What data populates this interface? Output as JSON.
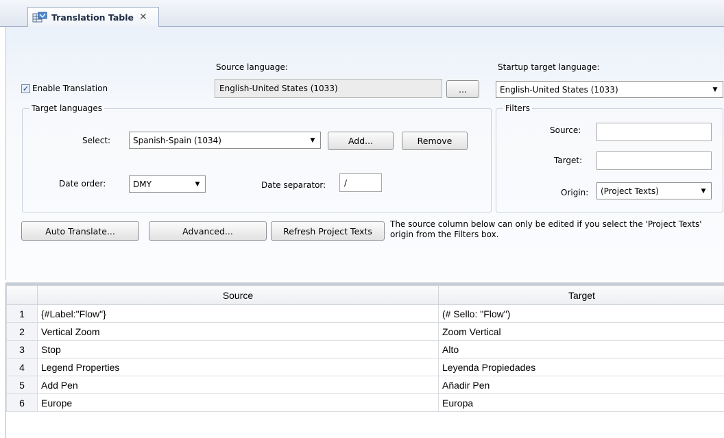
{
  "tab": {
    "title": "Translation Table",
    "close": "✕",
    "icon": "translation-table-icon"
  },
  "top": {
    "enable_translation": {
      "label": "Enable Translation",
      "checked": true
    },
    "source_language": {
      "label": "Source language:",
      "value": "English-United States (1033)",
      "browse_label": "..."
    },
    "startup_target": {
      "label": "Startup target language:",
      "value": "English-United States (1033)"
    }
  },
  "target_languages": {
    "title": "Target languages",
    "select_label": "Select:",
    "select_value": "Spanish-Spain (1034)",
    "add_label": "Add...",
    "remove_label": "Remove",
    "date_order_label": "Date order:",
    "date_order_value": "DMY",
    "date_separator_label": "Date separator:",
    "date_separator_value": "/"
  },
  "filters": {
    "title": "Filters",
    "source_label": "Source:",
    "source_value": "",
    "target_label": "Target:",
    "target_value": "",
    "origin_label": "Origin:",
    "origin_value": "(Project Texts)"
  },
  "actions": {
    "auto_translate": "Auto Translate...",
    "advanced": "Advanced...",
    "refresh": "Refresh Project Texts",
    "note": "The source column below can only be edited if you select the 'Project Texts' origin from the Filters box."
  },
  "grid": {
    "columns": [
      "",
      "Source",
      "Target"
    ],
    "rows": [
      {
        "num": "1",
        "source": "{#Label:\"Flow\"}",
        "target": "(# Sello: \"Flow\")"
      },
      {
        "num": "2",
        "source": "Vertical Zoom",
        "target": "Zoom Vertical"
      },
      {
        "num": "3",
        "source": "Stop",
        "target": "Alto"
      },
      {
        "num": "4",
        "source": "Legend Properties",
        "target": "Leyenda Propiedades"
      },
      {
        "num": "5",
        "source": "Add Pen",
        "target": "Añadir Pen"
      },
      {
        "num": "6",
        "source": "Europe",
        "target": "Europa"
      }
    ]
  },
  "colors": {
    "tab_border": "#9aabc4",
    "panel_bg": "#f7f9fc",
    "grid_header": "#eceef1"
  }
}
